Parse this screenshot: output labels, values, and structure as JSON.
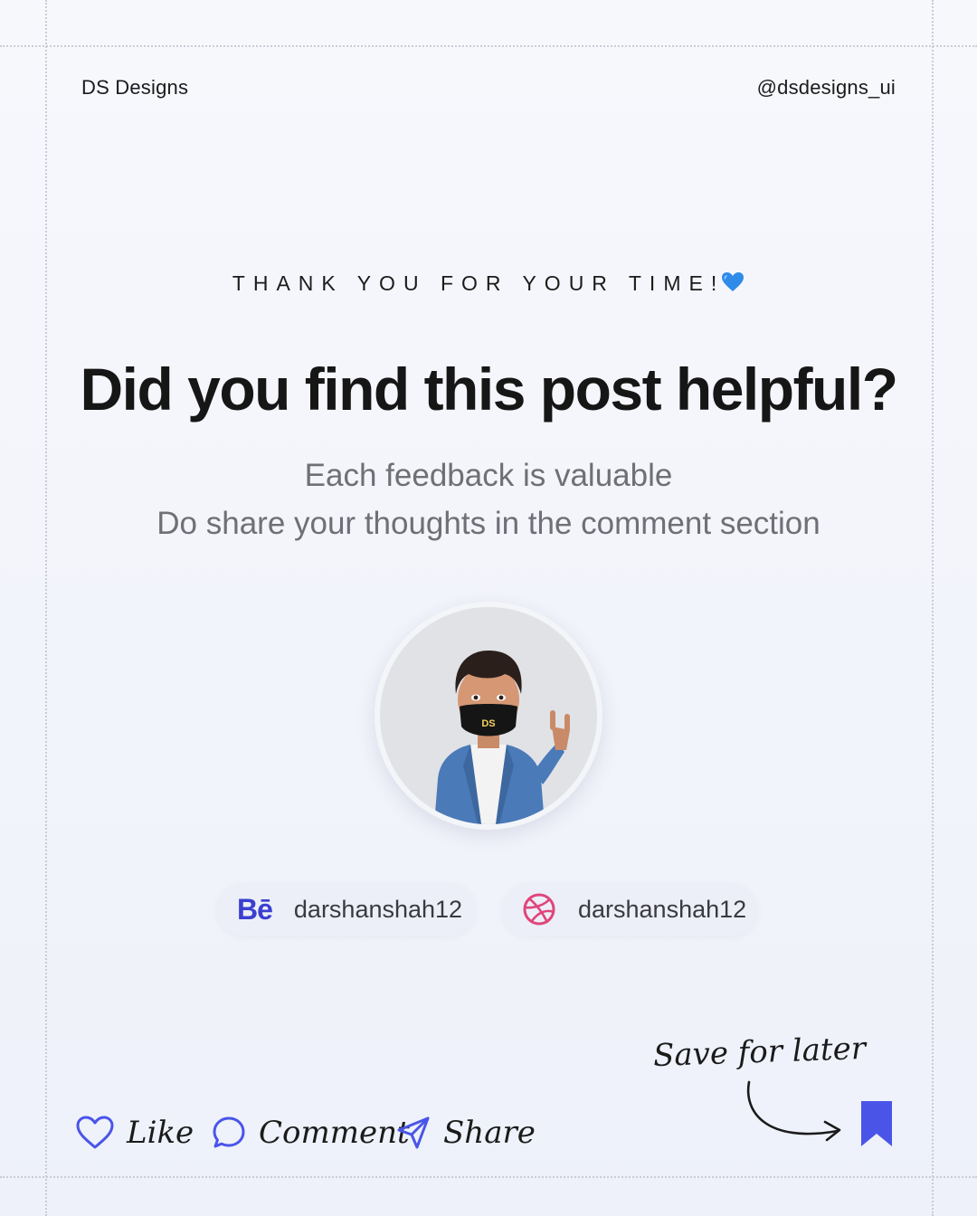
{
  "header": {
    "brand": "DS Designs",
    "handle": "@dsdesigns_ui"
  },
  "hero": {
    "eyebrow": "THANK YOU FOR YOUR TIME!",
    "eyebrow_emoji": "blue-heart-icon",
    "headline": "Did you find this post helpful?",
    "subline_1": "Each feedback is valuable",
    "subline_2": "Do share your thoughts in the comment section"
  },
  "avatar": {
    "mask_text": "DS"
  },
  "socials": [
    {
      "network": "Behance",
      "logo": "Bē",
      "icon": "behance-icon",
      "username": "darshanshah12",
      "color": "#3b3fd0"
    },
    {
      "network": "Dribbble",
      "icon": "dribbble-icon",
      "username": "darshanshah12",
      "color": "#e0457b"
    }
  ],
  "actions": {
    "like": "Like",
    "comment": "Comment",
    "share": "Share",
    "save_note": "Save for later"
  },
  "colors": {
    "accent": "#4a55e8",
    "icon_stroke": "#4a55e8",
    "text_dark": "#161616",
    "text_muted": "#6f6f75"
  }
}
